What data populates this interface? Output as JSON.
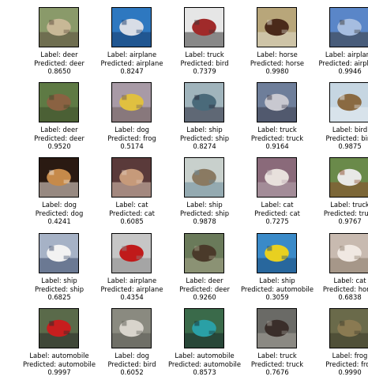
{
  "figure": {
    "rows": 5,
    "cols": 5,
    "label_prefix": "Label: ",
    "predicted_prefix": "Predicted: ",
    "items": [
      {
        "label": "deer",
        "predicted": "deer",
        "score": "0.8650",
        "colors": [
          "#8a9a6a",
          "#c8b896",
          "#5a4a3a"
        ]
      },
      {
        "label": "airplane",
        "predicted": "airplane",
        "score": "0.8247",
        "colors": [
          "#2e78c0",
          "#d8dde6",
          "#153a6a"
        ]
      },
      {
        "label": "truck",
        "predicted": "bird",
        "score": "0.7379",
        "colors": [
          "#e6e6e6",
          "#a02a2a",
          "#3a3a3a"
        ]
      },
      {
        "label": "horse",
        "predicted": "horse",
        "score": "0.9980",
        "colors": [
          "#b8a67a",
          "#4a2a1a",
          "#e0dccc"
        ]
      },
      {
        "label": "airplane",
        "predicted": "airplane",
        "score": "0.9946",
        "colors": [
          "#5a86c8",
          "#a6bde0",
          "#3a3a3a"
        ]
      },
      {
        "label": "deer",
        "predicted": "deer",
        "score": "0.9520",
        "colors": [
          "#5e7a44",
          "#8a6242",
          "#3c4a2a"
        ]
      },
      {
        "label": "dog",
        "predicted": "frog",
        "score": "0.5174",
        "colors": [
          "#a89aa6",
          "#e0c040",
          "#6e5c5a"
        ]
      },
      {
        "label": "ship",
        "predicted": "ship",
        "score": "0.8274",
        "colors": [
          "#a0b4bc",
          "#4a6a7a",
          "#2a2a3a"
        ]
      },
      {
        "label": "truck",
        "predicted": "truck",
        "score": "0.9164",
        "colors": [
          "#6e7e9a",
          "#c8c8d0",
          "#3a3a4a"
        ]
      },
      {
        "label": "bird",
        "predicted": "bird",
        "score": "0.9875",
        "colors": [
          "#c6d6e2",
          "#8a6a42",
          "#e8eef2"
        ]
      },
      {
        "label": "dog",
        "predicted": "dog",
        "score": "0.4241",
        "colors": [
          "#2a1a12",
          "#c68a4a",
          "#f0e6dc"
        ]
      },
      {
        "label": "cat",
        "predicted": "cat",
        "score": "0.6085",
        "colors": [
          "#5a3a3a",
          "#c69a7a",
          "#e0c8b8"
        ]
      },
      {
        "label": "ship",
        "predicted": "ship",
        "score": "0.9878",
        "colors": [
          "#c8d0cc",
          "#8a7a62",
          "#6a8a9a"
        ]
      },
      {
        "label": "cat",
        "predicted": "cat",
        "score": "0.7275",
        "colors": [
          "#8a6a7a",
          "#e8e0dc",
          "#b8a8b0"
        ]
      },
      {
        "label": "truck",
        "predicted": "truck",
        "score": "0.9767",
        "colors": [
          "#6a8a4a",
          "#e8e8e6",
          "#8a4a2a"
        ]
      },
      {
        "label": "ship",
        "predicted": "ship",
        "score": "0.6825",
        "colors": [
          "#a6b2c6",
          "#f2f2f2",
          "#3a4a6a"
        ]
      },
      {
        "label": "airplane",
        "predicted": "airplane",
        "score": "0.4354",
        "colors": [
          "#c6c6c6",
          "#c01a1a",
          "#8a8a8a"
        ]
      },
      {
        "label": "deer",
        "predicted": "deer",
        "score": "0.9260",
        "colors": [
          "#6a7a5a",
          "#4a3a2a",
          "#a6a68a"
        ]
      },
      {
        "label": "ship",
        "predicted": "automobile",
        "score": "0.3059",
        "colors": [
          "#3a8ac8",
          "#e8d020",
          "#1a4a7a"
        ]
      },
      {
        "label": "cat",
        "predicted": "horse",
        "score": "0.6838",
        "colors": [
          "#c8bab0",
          "#f0e8e2",
          "#8a7a6a"
        ]
      },
      {
        "label": "automobile",
        "predicted": "automobile",
        "score": "0.9997",
        "colors": [
          "#5a6a4a",
          "#c81e1e",
          "#2a2a2a"
        ]
      },
      {
        "label": "dog",
        "predicted": "bird",
        "score": "0.6052",
        "colors": [
          "#8a8a80",
          "#d8d4cc",
          "#5a5a52"
        ]
      },
      {
        "label": "automobile",
        "predicted": "automobile",
        "score": "0.8573",
        "colors": [
          "#3a6a4a",
          "#2aa0a6",
          "#1a2a2a"
        ]
      },
      {
        "label": "truck",
        "predicted": "truck",
        "score": "0.7676",
        "colors": [
          "#6a6a66",
          "#3a2e2a",
          "#a6a29a"
        ]
      },
      {
        "label": "frog",
        "predicted": "frog",
        "score": "0.9990",
        "colors": [
          "#6a6a4a",
          "#8a7a52",
          "#3a3a2a"
        ]
      }
    ]
  }
}
